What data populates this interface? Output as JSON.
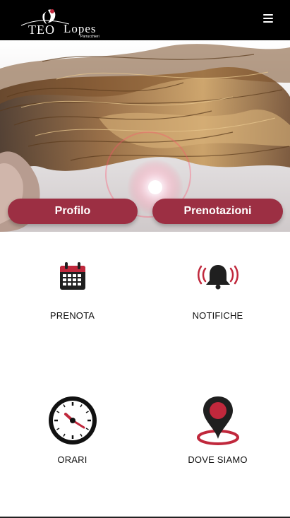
{
  "header": {
    "logo_text": "TEO Lopes",
    "logo_subtitle": "Parrucchieri",
    "menu_icon": "hamburger-menu-icon"
  },
  "hero": {
    "buttons": [
      {
        "label": "Profilo"
      },
      {
        "label": "Prenotazioni"
      }
    ]
  },
  "tiles": [
    {
      "label": "PRENOTA",
      "icon": "calendar-icon"
    },
    {
      "label": "NOTIFICHE",
      "icon": "bell-alarm-icon"
    },
    {
      "label": "ORARI",
      "icon": "clock-icon"
    },
    {
      "label": "DOVE SIAMO",
      "icon": "map-pin-icon"
    }
  ],
  "colors": {
    "accent": "#9c2f43",
    "icon_red": "#c0283c",
    "header_bg": "#000000"
  }
}
